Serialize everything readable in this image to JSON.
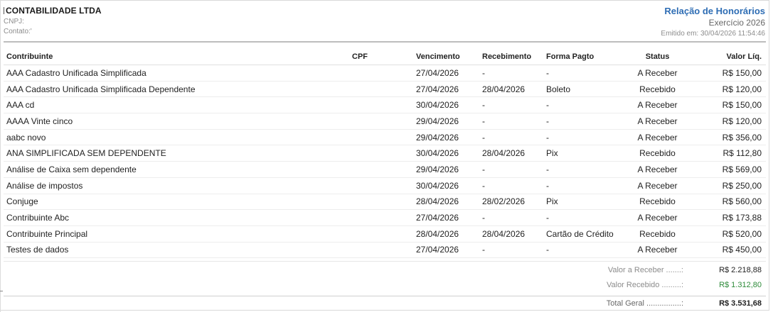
{
  "header": {
    "company": "CONTABILIDADE LTDA",
    "cnpj_label": "CNPJ:",
    "contact_label": "Contato:'",
    "report_title": "Relação de Honorários",
    "exercise": "Exercício 2026",
    "emitted": "Emitido em: 30/04/2026 11:54:46"
  },
  "table": {
    "columns": {
      "contribuinte": "Contribuinte",
      "cpf": "CPF",
      "vencimento": "Vencimento",
      "recebimento": "Recebimento",
      "forma": "Forma Pagto",
      "status": "Status",
      "valor": "Valor Líq."
    },
    "rows": [
      {
        "contribuinte": "AAA Cadastro Unificada Simplificada",
        "cpf": "",
        "vencimento": "27/04/2026",
        "recebimento": "-",
        "forma": "-",
        "status": "A Receber",
        "valor": "R$ 150,00"
      },
      {
        "contribuinte": "AAA Cadastro Unificada Simplificada Dependente",
        "cpf": "",
        "vencimento": "27/04/2026",
        "recebimento": "28/04/2026",
        "forma": "Boleto",
        "status": "Recebido",
        "valor": "R$ 120,00"
      },
      {
        "contribuinte": "AAA cd",
        "cpf": "",
        "vencimento": "30/04/2026",
        "recebimento": "-",
        "forma": "-",
        "status": "A Receber",
        "valor": "R$ 150,00"
      },
      {
        "contribuinte": "AAAA Vinte cinco",
        "cpf": "",
        "vencimento": "29/04/2026",
        "recebimento": "-",
        "forma": "-",
        "status": "A Receber",
        "valor": "R$ 120,00"
      },
      {
        "contribuinte": "aabc novo",
        "cpf": "",
        "vencimento": "29/04/2026",
        "recebimento": "-",
        "forma": "-",
        "status": "A Receber",
        "valor": "R$ 356,00"
      },
      {
        "contribuinte": "ANA SIMPLIFICADA SEM DEPENDENTE",
        "cpf": "",
        "vencimento": "30/04/2026",
        "recebimento": "28/04/2026",
        "forma": "Pix",
        "status": "Recebido",
        "valor": "R$ 112,80"
      },
      {
        "contribuinte": "Análise de Caixa sem dependente",
        "cpf": "",
        "vencimento": "29/04/2026",
        "recebimento": "-",
        "forma": "-",
        "status": "A Receber",
        "valor": "R$ 569,00"
      },
      {
        "contribuinte": "Análise de impostos",
        "cpf": "",
        "vencimento": "30/04/2026",
        "recebimento": "-",
        "forma": "-",
        "status": "A Receber",
        "valor": "R$ 250,00"
      },
      {
        "contribuinte": "Conjuge",
        "cpf": "",
        "vencimento": "28/04/2026",
        "recebimento": "28/02/2026",
        "forma": "Pix",
        "status": "Recebido",
        "valor": "R$ 560,00"
      },
      {
        "contribuinte": "Contribuinte Abc",
        "cpf": "",
        "vencimento": "27/04/2026",
        "recebimento": "-",
        "forma": "-",
        "status": "A Receber",
        "valor": "R$ 173,88"
      },
      {
        "contribuinte": "Contribuinte Principal",
        "cpf": "",
        "vencimento": "28/04/2026",
        "recebimento": "28/04/2026",
        "forma": "Cartão de Crédito",
        "status": "Recebido",
        "valor": "R$ 520,00"
      },
      {
        "contribuinte": "Testes de dados",
        "cpf": "",
        "vencimento": "27/04/2026",
        "recebimento": "-",
        "forma": "-",
        "status": "A Receber",
        "valor": "R$ 450,00"
      }
    ]
  },
  "totals": {
    "a_receber_label": "Valor a Receber .......:",
    "a_receber_value": "R$ 2.218,88",
    "recebido_label": "Valor Recebido .........:",
    "recebido_value": "R$ 1.312,80",
    "geral_label": "Total Geral ................:",
    "geral_value": "R$ 3.531,68"
  },
  "colors": {
    "title_blue": "#2e6db4",
    "received_green": "#2e8b3a"
  }
}
